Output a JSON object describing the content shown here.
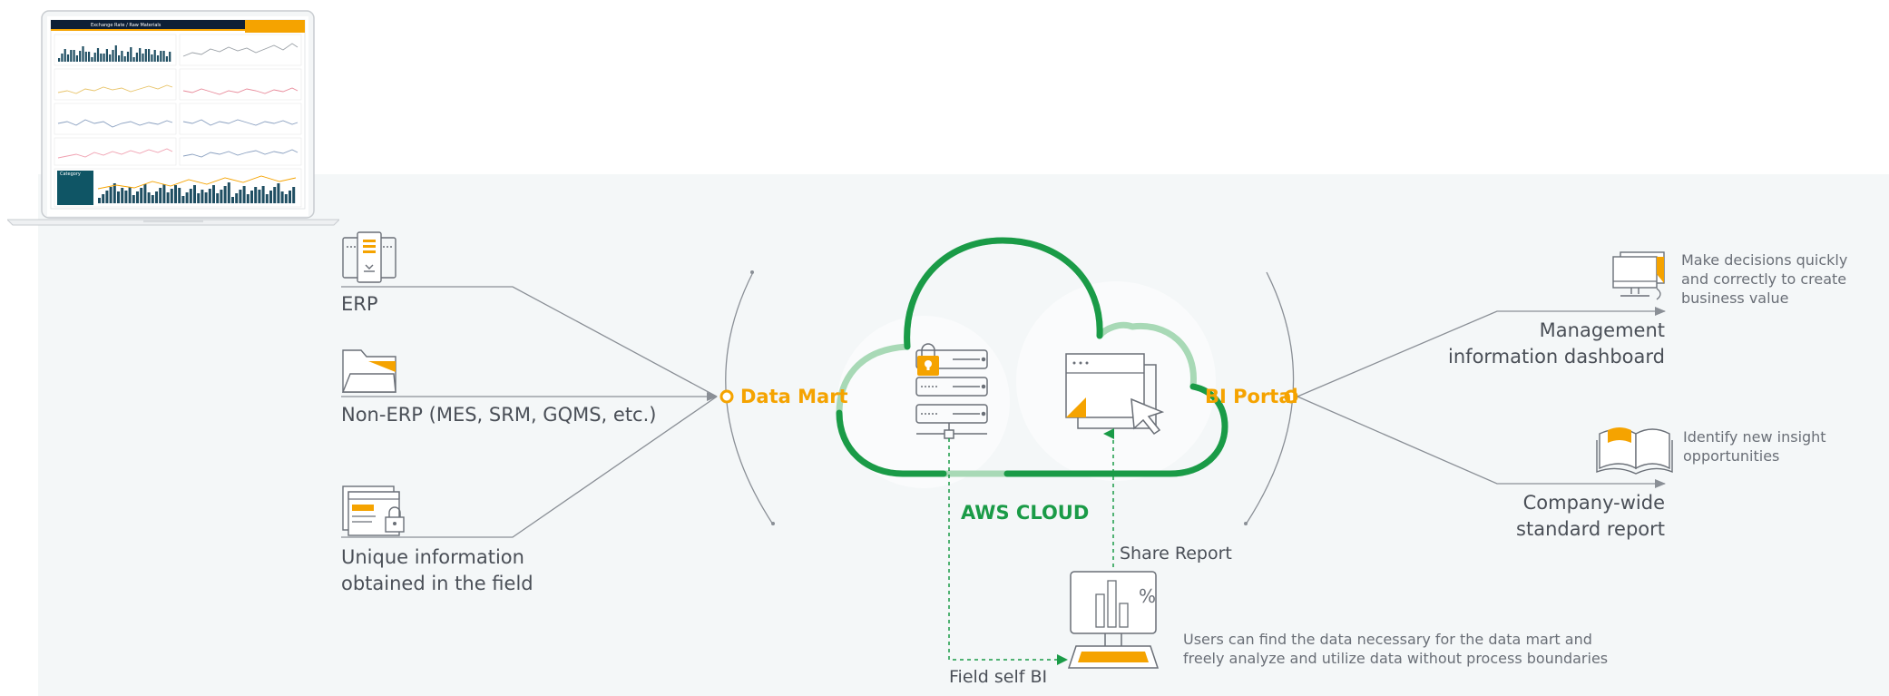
{
  "laptop": {
    "dashboard_title": "Exchange Rate / Raw Materials",
    "category_label": "Category"
  },
  "sources": [
    {
      "label": "ERP",
      "icon": "erp-server-icon"
    },
    {
      "label": "Non-ERP (MES, SRM, GQMS, etc.)",
      "icon": "folder-icon"
    },
    {
      "label_lines": [
        "Unique information",
        "obtained in the field"
      ],
      "icon": "document-lock-icon"
    }
  ],
  "hubs": {
    "data_mart": "Data Mart",
    "bi_portal": "BI Portal",
    "aws_cloud": "AWS CLOUD"
  },
  "outputs": [
    {
      "label_lines": [
        "Management",
        "information dashboard"
      ],
      "note_lines": [
        "Make decisions quickly",
        "and correctly to create",
        "business value"
      ],
      "icon": "monitor-icon"
    },
    {
      "label_lines": [
        "Company-wide",
        "standard report"
      ],
      "note_lines": [
        "Identify new insight",
        "opportunities"
      ],
      "icon": "open-book-icon"
    }
  ],
  "self_bi": {
    "share_report": "Share Report",
    "field_self_bi": "Field self BI",
    "note_lines": [
      "Users can find the data necessary for the data mart and",
      "freely analyze and utilize data without process boundaries"
    ]
  },
  "colors": {
    "accent": "#f5a300",
    "green": "#1a9b47",
    "light_green": "#a8d9b6",
    "line": "#8a8f96",
    "panel": "#f4f7f8"
  }
}
